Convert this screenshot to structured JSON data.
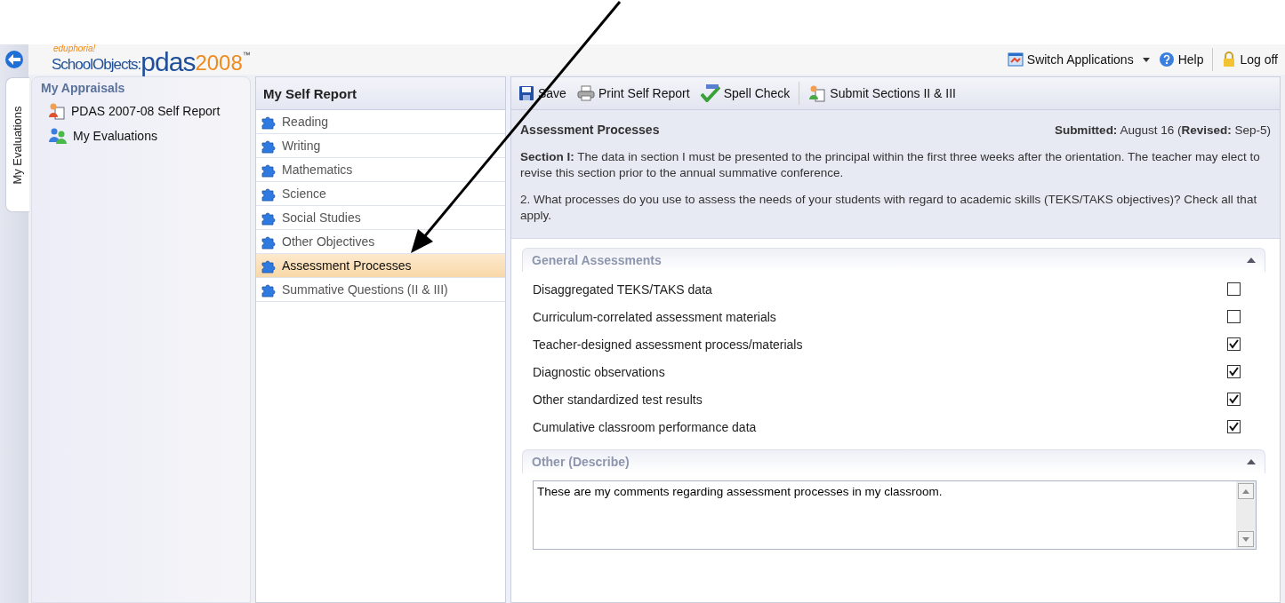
{
  "app_strip": {
    "vertical_tab": "My Evaluations"
  },
  "header": {
    "logo": {
      "small": "eduphoria!",
      "brand": "SchoolObjects:",
      "product": "pdas",
      "year": "2008",
      "mark": "™"
    },
    "links": [
      {
        "label": "Switch Applications",
        "kind": "switch",
        "divider_before": false
      },
      {
        "label": "Help",
        "kind": "help",
        "divider_before": false
      },
      {
        "label": "Log off",
        "kind": "lock",
        "divider_before": true
      }
    ]
  },
  "sidebar": {
    "title": "My Appraisals",
    "items": [
      {
        "label": "PDAS 2007-08 Self Report",
        "kind": "report"
      },
      {
        "label": "My Evaluations",
        "kind": "evaluations"
      }
    ]
  },
  "report_nav": {
    "title": "My Self Report",
    "items": [
      {
        "label": "Reading",
        "selected": false
      },
      {
        "label": "Writing",
        "selected": false
      },
      {
        "label": "Mathematics",
        "selected": false
      },
      {
        "label": "Science",
        "selected": false
      },
      {
        "label": "Social Studies",
        "selected": false
      },
      {
        "label": "Other Objectives",
        "selected": false
      },
      {
        "label": "Assessment Processes",
        "selected": true
      },
      {
        "label": "Summative Questions (II & III)",
        "selected": false
      }
    ]
  },
  "toolbar": [
    {
      "label": "Save",
      "kind": "save",
      "divider_before": false
    },
    {
      "label": "Print Self Report",
      "kind": "print",
      "divider_before": false
    },
    {
      "label": "Spell Check",
      "kind": "spell",
      "divider_before": false
    },
    {
      "label": "Submit Sections II & III",
      "kind": "submit",
      "divider_before": true
    }
  ],
  "section": {
    "title": "Assessment Processes",
    "submitted": "**Submitted:** August 16 (**Revised:** Sep-5)",
    "intro": "**Section I:** The data in section I must be presented to the principal within the first three weeks after the orientation. The teacher may elect to revise this section prior to the annual summative conference.",
    "question": "2. What processes do you use to assess the needs of your students with regard to academic skills (TEKS/TAKS objectives)? Check all that apply."
  },
  "groups": [
    {
      "title": "General Assessments",
      "expanded": true,
      "kind": "checklist",
      "items": [
        {
          "label": "Disaggregated TEKS/TAKS data",
          "checked": false
        },
        {
          "label": "Curriculum-correlated assessment materials",
          "checked": false
        },
        {
          "label": "Teacher-designed assessment process/materials",
          "checked": true
        },
        {
          "label": "Diagnostic observations",
          "checked": true
        },
        {
          "label": "Other standardized test results",
          "checked": true
        },
        {
          "label": "Cumulative classroom performance data",
          "checked": true
        }
      ]
    },
    {
      "title": "Other (Describe)",
      "expanded": true,
      "kind": "text",
      "value": "These are my comments regarding assessment processes in my classroom."
    }
  ]
}
